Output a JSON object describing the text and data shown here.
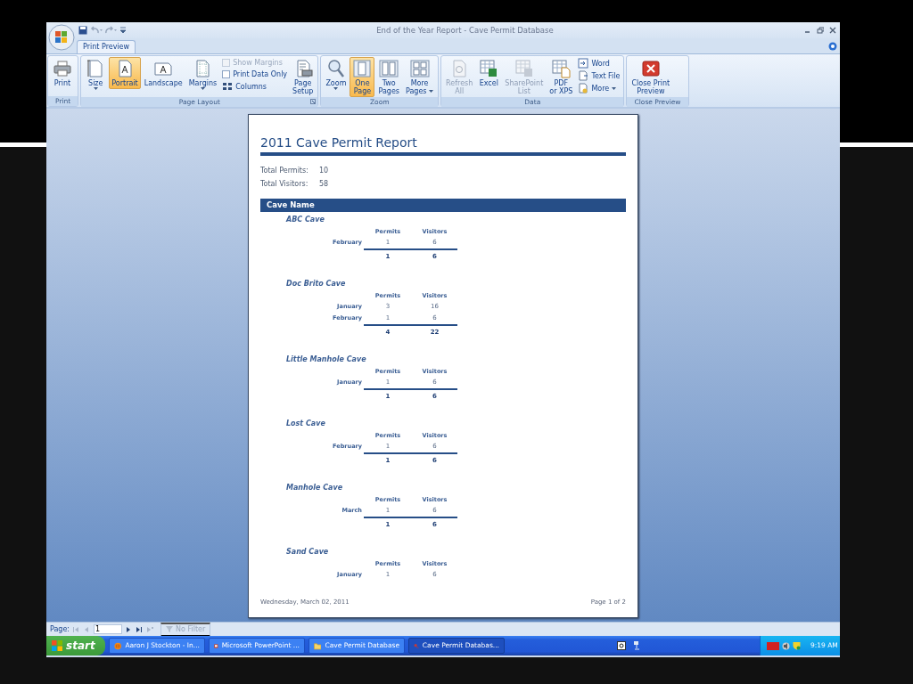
{
  "window": {
    "title": "End of the Year Report - Cave Permit Database"
  },
  "ribbon": {
    "tabs": [
      {
        "label": "Print Preview",
        "selected": true
      }
    ],
    "groups": [
      {
        "label": "Print",
        "dialog_launcher": false,
        "items": [
          {
            "kind": "large",
            "lines": [
              "Print"
            ],
            "dropdown": false,
            "selected": false,
            "disabled": false
          }
        ]
      },
      {
        "label": "Page Layout",
        "dialog_launcher": true,
        "items": [
          {
            "kind": "large",
            "lines": [
              "Size"
            ],
            "dropdown": true,
            "selected": false,
            "disabled": false
          },
          {
            "kind": "large",
            "lines": [
              "Portrait"
            ],
            "dropdown": false,
            "selected": true,
            "disabled": false
          },
          {
            "kind": "large",
            "lines": [
              "Landscape"
            ],
            "dropdown": false,
            "selected": false,
            "disabled": false
          },
          {
            "kind": "large",
            "lines": [
              "Margins"
            ],
            "dropdown": true,
            "selected": false,
            "disabled": false
          },
          {
            "kind": "check",
            "label": "Show Margins",
            "checked": false,
            "disabled": true
          },
          {
            "kind": "check",
            "label": "Print Data Only",
            "checked": false,
            "disabled": false
          },
          {
            "kind": "small",
            "label": "Columns",
            "dropdown": false,
            "disabled": false
          },
          {
            "kind": "large",
            "lines": [
              "Page",
              "Setup"
            ],
            "dropdown": false,
            "selected": false,
            "disabled": false
          }
        ]
      },
      {
        "label": "Zoom",
        "dialog_launcher": false,
        "items": [
          {
            "kind": "large",
            "lines": [
              "Zoom"
            ],
            "dropdown": true,
            "selected": false,
            "disabled": false
          },
          {
            "kind": "large",
            "lines": [
              "One",
              "Page"
            ],
            "dropdown": false,
            "selected": true,
            "disabled": false
          },
          {
            "kind": "large",
            "lines": [
              "Two",
              "Pages"
            ],
            "dropdown": false,
            "selected": false,
            "disabled": false
          },
          {
            "kind": "large",
            "lines": [
              "More",
              "Pages"
            ],
            "dropdown": true,
            "selected": false,
            "disabled": false
          }
        ]
      },
      {
        "label": "Data",
        "dialog_launcher": false,
        "items": [
          {
            "kind": "large",
            "lines": [
              "Refresh",
              "All"
            ],
            "dropdown": false,
            "selected": false,
            "disabled": true
          },
          {
            "kind": "large",
            "lines": [
              "Excel"
            ],
            "dropdown": false,
            "selected": false,
            "disabled": false
          },
          {
            "kind": "large",
            "lines": [
              "SharePoint",
              "List"
            ],
            "dropdown": false,
            "selected": false,
            "disabled": true
          },
          {
            "kind": "large",
            "lines": [
              "PDF",
              "or XPS"
            ],
            "dropdown": false,
            "selected": false,
            "disabled": false
          },
          {
            "kind": "small",
            "label": "Word",
            "dropdown": false,
            "disabled": false
          },
          {
            "kind": "small",
            "label": "Text File",
            "dropdown": false,
            "disabled": false
          },
          {
            "kind": "small",
            "label": "More",
            "dropdown": true,
            "disabled": false
          }
        ]
      },
      {
        "label": "Close Preview",
        "dialog_launcher": false,
        "items": [
          {
            "kind": "large",
            "lines": [
              "Close Print",
              "Preview"
            ],
            "dropdown": false,
            "selected": false,
            "disabled": false
          }
        ]
      }
    ]
  },
  "report": {
    "title": "2011 Cave Permit Report",
    "summary": [
      {
        "label": "Total Permits:",
        "value": "10"
      },
      {
        "label": "Total Visitors:",
        "value": "58"
      }
    ],
    "header": "Cave Name",
    "caves": [
      {
        "name": "ABC Cave",
        "columns": [
          "Permits",
          "Visitors"
        ],
        "rows": [
          {
            "month": "February",
            "permits": "1",
            "visitors": "6"
          }
        ],
        "total": {
          "permits": "1",
          "visitors": "6"
        }
      },
      {
        "name": "Doc Brito Cave",
        "columns": [
          "Permits",
          "Visitors"
        ],
        "rows": [
          {
            "month": "January",
            "permits": "3",
            "visitors": "16"
          },
          {
            "month": "February",
            "permits": "1",
            "visitors": "6"
          }
        ],
        "total": {
          "permits": "4",
          "visitors": "22"
        }
      },
      {
        "name": "Little Manhole Cave",
        "columns": [
          "Permits",
          "Visitors"
        ],
        "rows": [
          {
            "month": "January",
            "permits": "1",
            "visitors": "6"
          }
        ],
        "total": {
          "permits": "1",
          "visitors": "6"
        }
      },
      {
        "name": "Lost Cave",
        "columns": [
          "Permits",
          "Visitors"
        ],
        "rows": [
          {
            "month": "February",
            "permits": "1",
            "visitors": "6"
          }
        ],
        "total": {
          "permits": "1",
          "visitors": "6"
        }
      },
      {
        "name": "Manhole Cave",
        "columns": [
          "Permits",
          "Visitors"
        ],
        "rows": [
          {
            "month": "March",
            "permits": "1",
            "visitors": "6"
          }
        ],
        "total": {
          "permits": "1",
          "visitors": "6"
        }
      },
      {
        "name": "Sand Cave",
        "columns": [
          "Permits",
          "Visitors"
        ],
        "rows": [
          {
            "month": "January",
            "permits": "1",
            "visitors": "6"
          }
        ]
      }
    ],
    "footer": {
      "date": "Wednesday, March 02, 2011",
      "page": "Page 1 of 2"
    }
  },
  "status_bar": {
    "label": "Page:",
    "nav_before": [
      {
        "kind": "first",
        "disabled": true
      },
      {
        "kind": "prev",
        "disabled": true
      }
    ],
    "page_value": "1",
    "nav_after": [
      {
        "kind": "next",
        "disabled": false
      },
      {
        "kind": "last",
        "disabled": false
      },
      {
        "kind": "new",
        "disabled": true
      }
    ],
    "filter": {
      "label": "No Filter",
      "disabled": true
    }
  },
  "taskbar": {
    "start": "start",
    "tasks": [
      {
        "label": "Aaron J Stockton - In...",
        "kind": "browser",
        "selected": false
      },
      {
        "label": "Microsoft PowerPoint ...",
        "kind": "presentation",
        "selected": false
      },
      {
        "label": "Cave Permit Database",
        "kind": "folder",
        "selected": false
      },
      {
        "label": "Cave Permit Databas...",
        "kind": "database",
        "selected": true
      }
    ],
    "clock": "9:19 AM"
  }
}
